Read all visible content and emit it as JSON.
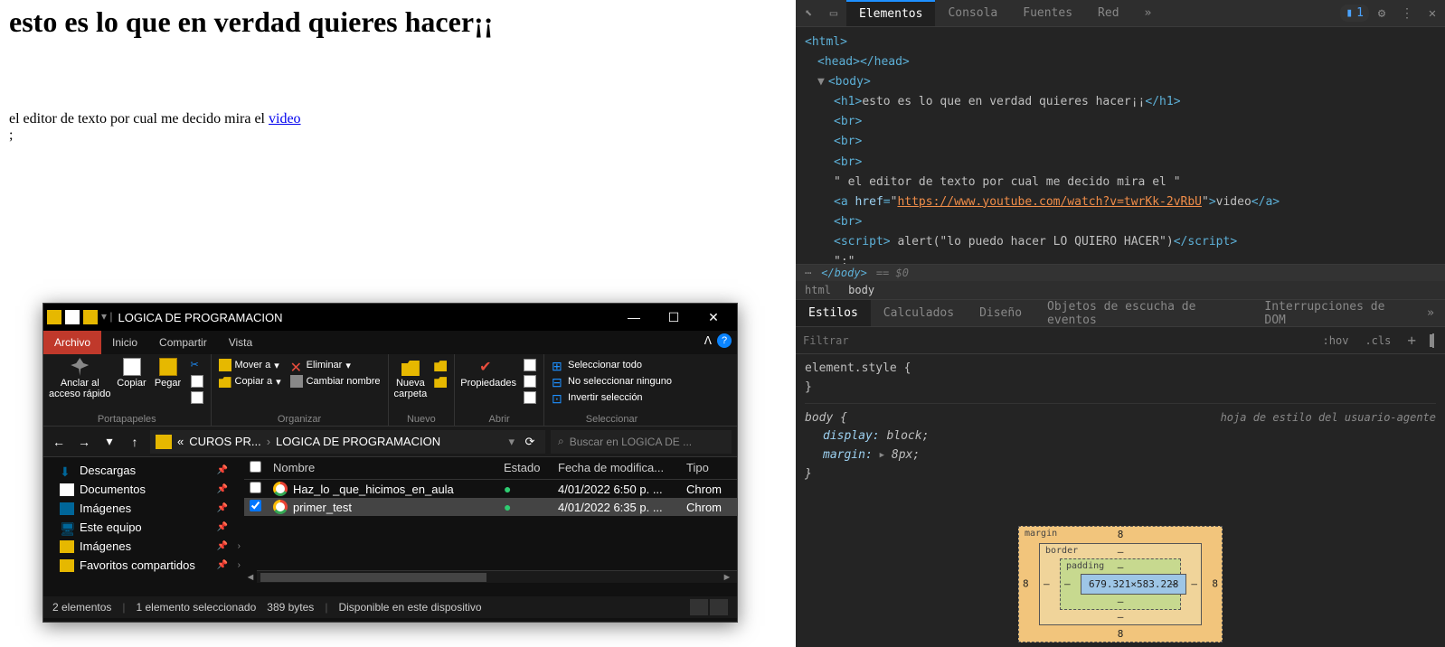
{
  "page": {
    "heading": "esto es lo que en verdad quieres hacer¡¡",
    "paragraph_prefix": "el editor de texto por cual me decido mira el ",
    "link_text": "video",
    "link_href": "https://www.youtube.com/watch?v=twrKk-2vRbU",
    "trailing": ";"
  },
  "explorer": {
    "title": "LOGICA DE PROGRAMACION",
    "win": {
      "minimize": "—",
      "maximize": "☐",
      "close": "✕"
    },
    "tabs": {
      "archivo": "Archivo",
      "inicio": "Inicio",
      "compartir": "Compartir",
      "vista": "Vista"
    },
    "ribbon": {
      "anclar": "Anclar al\nacceso rápido",
      "copiar": "Copiar",
      "pegar": "Pegar",
      "portapapeles": "Portapapeles",
      "mover_a": "Mover a",
      "copiar_a": "Copiar a",
      "eliminar": "Eliminar",
      "cambiar_nombre": "Cambiar nombre",
      "organizar": "Organizar",
      "nueva_carpeta": "Nueva\ncarpeta",
      "nuevo": "Nuevo",
      "propiedades": "Propiedades",
      "abrir": "Abrir",
      "seleccionar_todo": "Seleccionar todo",
      "no_seleccionar": "No seleccionar ninguno",
      "invertir": "Invertir selección",
      "seleccionar": "Seleccionar"
    },
    "nav": {
      "bc1": "CUROS PR...",
      "bc2": "LOGICA DE PROGRAMACION",
      "search_placeholder": "Buscar en LOGICA DE ..."
    },
    "sidebar": [
      {
        "icon": "dl",
        "label": "Descargas",
        "pin": true,
        "chev": false
      },
      {
        "icon": "doc",
        "label": "Documentos",
        "pin": true,
        "chev": false
      },
      {
        "icon": "img",
        "label": "Imágenes",
        "pin": true,
        "chev": false
      },
      {
        "icon": "pc",
        "label": "Este equipo",
        "pin": true,
        "chev": false
      },
      {
        "icon": "fav",
        "label": "Imágenes",
        "pin": true,
        "chev": true
      },
      {
        "icon": "fav",
        "label": "Favoritos compartidos",
        "pin": true,
        "chev": true
      }
    ],
    "columns": {
      "nombre": "Nombre",
      "estado": "Estado",
      "fecha": "Fecha de modifica...",
      "tipo": "Tipo"
    },
    "files": [
      {
        "name": "Haz_lo _que_hicimos_en_aula",
        "fecha": "4/01/2022 6:50 p. ...",
        "tipo": "Chrom",
        "selected": false,
        "checked": false
      },
      {
        "name": "primer_test",
        "fecha": "4/01/2022 6:35 p. ...",
        "tipo": "Chrom",
        "selected": true,
        "checked": true
      }
    ],
    "status": {
      "elementos": "2 elementos",
      "seleccionado": "1 elemento seleccionado",
      "bytes": "389 bytes",
      "disponible": "Disponible en este dispositivo"
    }
  },
  "devtools": {
    "header_tabs": [
      "Elementos",
      "Consola",
      "Fuentes",
      "Red"
    ],
    "warn_count": "1",
    "elements": {
      "html_open": "<html>",
      "head": "<head></head>",
      "body_open": "<body>",
      "h1_text": "esto es lo que en verdad quieres hacer¡¡",
      "br": "<br>",
      "text_node": " el editor de texto por cual me decido mira el ",
      "a_href": "https://www.youtube.com/watch?v=twrKk-2vRbU",
      "a_text": "video",
      "script_text": " alert(\"lo puedo hacer LO QUIERO HACER\")",
      "semicolon": ";",
      "body_close": "</body>",
      "eq0": "== $0"
    },
    "crumb": [
      "html",
      "body"
    ],
    "subtabs": [
      "Estilos",
      "Calculados",
      "Diseño",
      "Objetos de escucha de eventos",
      "Interrupciones de DOM"
    ],
    "filter": {
      "placeholder": "Filtrar",
      "hov": ":hov",
      "cls": ".cls"
    },
    "styles": {
      "element_style": "element.style {",
      "close": "}",
      "body_sel": "body {",
      "display": "display:",
      "display_val": "block;",
      "margin": "margin:",
      "margin_val": "8px;",
      "source": "hoja de estilo del usuario-agente"
    },
    "boxmodel": {
      "margin_label": "margin",
      "border_label": "border",
      "padding_label": "padding",
      "margin_val": "8",
      "dash": "–",
      "content": "679.321×583.228"
    }
  }
}
